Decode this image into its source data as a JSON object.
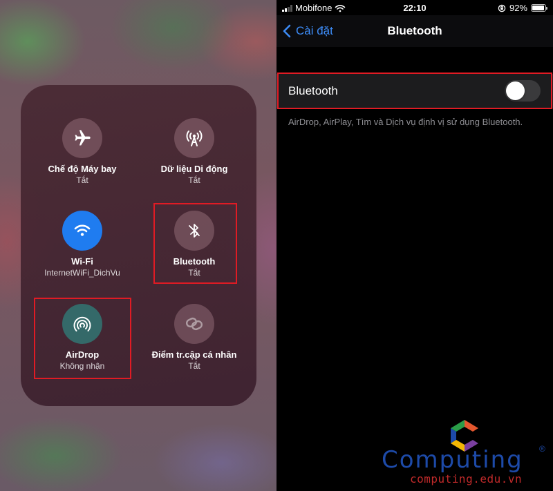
{
  "control_center": {
    "tiles": [
      {
        "title": "Chế độ Máy bay",
        "subtitle": "Tắt",
        "icon": "airplane-icon"
      },
      {
        "title": "Dữ liệu Di động",
        "subtitle": "Tắt",
        "icon": "cellular-antenna-icon"
      },
      {
        "title": "Wi-Fi",
        "subtitle": "InternetWiFi_DichVu",
        "icon": "wifi-icon"
      },
      {
        "title": "Bluetooth",
        "subtitle": "Tắt",
        "icon": "bluetooth-off-icon"
      },
      {
        "title": "AirDrop",
        "subtitle": "Không nhận",
        "icon": "airdrop-icon"
      },
      {
        "title": "Điểm tr.cập cá nhân",
        "subtitle": "Tắt",
        "icon": "personal-hotspot-icon"
      }
    ]
  },
  "status_bar": {
    "carrier": "Mobifone",
    "time": "22:10",
    "battery": "92%"
  },
  "nav": {
    "back_label": "Cài đặt",
    "title": "Bluetooth"
  },
  "settings": {
    "bluetooth_label": "Bluetooth",
    "bluetooth_enabled": false,
    "footnote": "AirDrop, AirPlay, Tìm và Dịch vụ định vị sử dụng Bluetooth."
  },
  "watermark": {
    "brand": "Computing",
    "reg_mark": "®",
    "url": "computing.edu.vn"
  },
  "colors": {
    "highlight": "#e01b24",
    "ios_blue": "#3d8cf7",
    "wifi_active": "#1f7cf0"
  }
}
